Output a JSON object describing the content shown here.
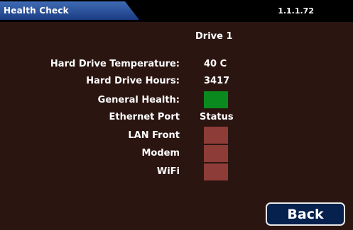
{
  "header": {
    "title": "Health Check",
    "version": "1.1.1.72"
  },
  "drive": {
    "heading": "Drive 1",
    "temperature_label": "Hard Drive Temperature:",
    "temperature_value": "40 C",
    "hours_label": "Hard Drive Hours:",
    "hours_value": "3417",
    "health_label": "General Health:",
    "health_color": "#0a8a1e"
  },
  "ethernet": {
    "port_label": "Ethernet Port",
    "status_label": "Status",
    "ports": [
      {
        "label": "LAN Front",
        "status_color": "#8e3c38"
      },
      {
        "label": "Modem",
        "status_color": "#8e3c38"
      },
      {
        "label": "WiFi",
        "status_color": "#8e3c38"
      }
    ]
  },
  "footer": {
    "back_label": "Back"
  }
}
